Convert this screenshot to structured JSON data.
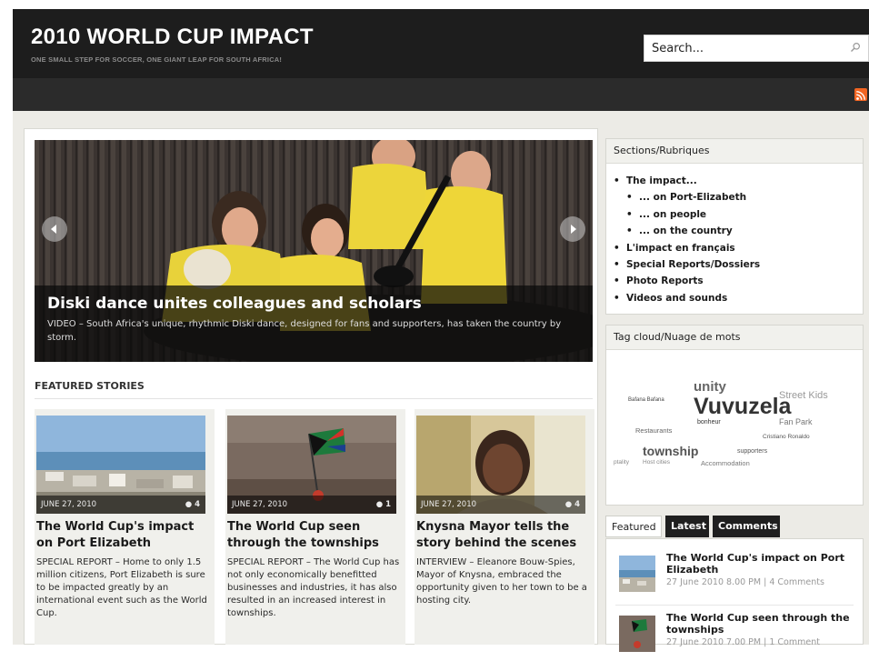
{
  "header": {
    "title": "2010 WORLD CUP IMPACT",
    "tagline": "ONE SMALL STEP FOR SOCCER, ONE GIANT LEAP FOR SOUTH AFRICA!",
    "search_placeholder": "Search..."
  },
  "slider": {
    "title": "Diski dance unites colleagues and scholars",
    "description": "VIDEO – South Africa's unique, rhythmic Diski dance, designed for fans and supporters, has taken the country by storm."
  },
  "featured": {
    "heading": "FEATURED STORIES",
    "stories": [
      {
        "date": "JUNE 27, 2010",
        "comments": "4",
        "title": "The World Cup's impact on Port Elizabeth",
        "excerpt": "SPECIAL REPORT – Home to only 1.5 million citizens, Port Elizabeth is sure to be impacted greatly by an international event such as the World Cup."
      },
      {
        "date": "JUNE 27, 2010",
        "comments": "1",
        "title": "The World Cup seen through the townships",
        "excerpt": "SPECIAL REPORT – The World Cup has not only economically benefitted businesses and industries, it has also resulted in an increased interest in townships."
      },
      {
        "date": "JUNE 27, 2010",
        "comments": "4",
        "title": "Knysna Mayor tells the story behind the scenes",
        "excerpt": "INTERVIEW – Eleanore Bouw-Spies, Mayor of Knysna, embraced the opportunity given to her town to be a hosting city."
      }
    ]
  },
  "sections": {
    "heading": "Sections/Rubriques",
    "items": [
      "The impact...",
      "... on Port-Elizabeth",
      "... on people",
      "... on the country",
      "L'impact en français",
      "Special Reports/Dossiers",
      "Photo Reports",
      "Videos and sounds"
    ]
  },
  "tags": {
    "heading": "Tag cloud/Nuage de mots",
    "words": [
      "unity",
      "Vuvuzela",
      "township",
      "Street Kids",
      "Fan Park",
      "Cristiano Ronaldo",
      "Bafana Bafana",
      "Restaurants",
      "bonheur",
      "supporters",
      "Accommodation",
      "ptality",
      "Host cities"
    ]
  },
  "tabs": {
    "featured": "Featured",
    "latest": "Latest",
    "comments": "Comments",
    "items": [
      {
        "title": "The World Cup's impact on Port Elizabeth",
        "meta": "27 June 2010 8.00 PM | 4 Comments"
      },
      {
        "title": "The World Cup seen through the townships",
        "meta": "27 June 2010 7.00 PM | 1 Comment"
      }
    ]
  },
  "colors": {
    "header_bg": "#1d1d1d",
    "page_bg": "#ecebe6",
    "rss": "#f26522"
  }
}
